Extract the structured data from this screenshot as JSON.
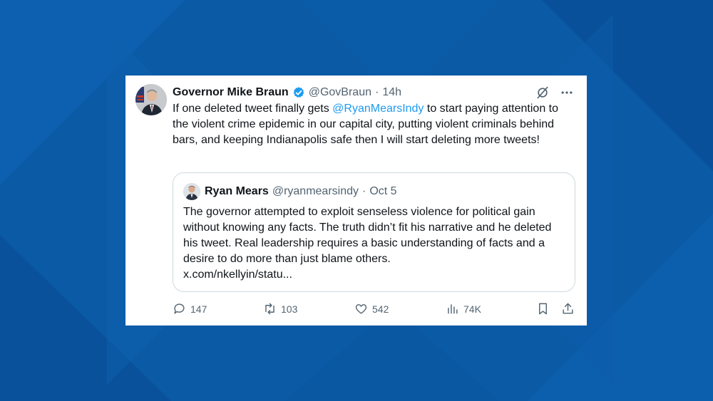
{
  "tweet": {
    "author_name": "Governor Mike Braun",
    "handle": "@GovBraun",
    "separator": "·",
    "time": "14h",
    "text_before_mention": "If one deleted tweet finally gets ",
    "mention": "@RyanMearsIndy",
    "text_after_mention": " to start paying attention to the violent crime epidemic in our capital city, putting violent criminals behind bars, and keeping Indianapolis safe then I will start deleting more tweets!"
  },
  "quoted_tweet": {
    "author_name": "Ryan Mears",
    "handle": "@ryanmearsindy",
    "separator": "·",
    "date": "Oct 5",
    "text": "The governor attempted to exploit senseless violence for political gain without knowing any facts. The truth didn’t fit his narrative and he deleted his tweet. Real leadership requires a basic understanding of facts and a desire to do more than just blame others.",
    "link": "x.com/nkellyin/statu..."
  },
  "actions": {
    "replies": "147",
    "retweets": "103",
    "likes": "542",
    "views": "74K"
  },
  "icons": [
    "verified-badge-icon",
    "grok-icon",
    "more-icon",
    "reply-icon",
    "retweet-icon",
    "like-icon",
    "views-icon",
    "bookmark-icon",
    "share-icon"
  ],
  "colors": {
    "background": "#0a5aa8",
    "card": "#ffffff",
    "accent": "#1d9bf0",
    "text": "#0f1419",
    "muted": "#536471"
  }
}
